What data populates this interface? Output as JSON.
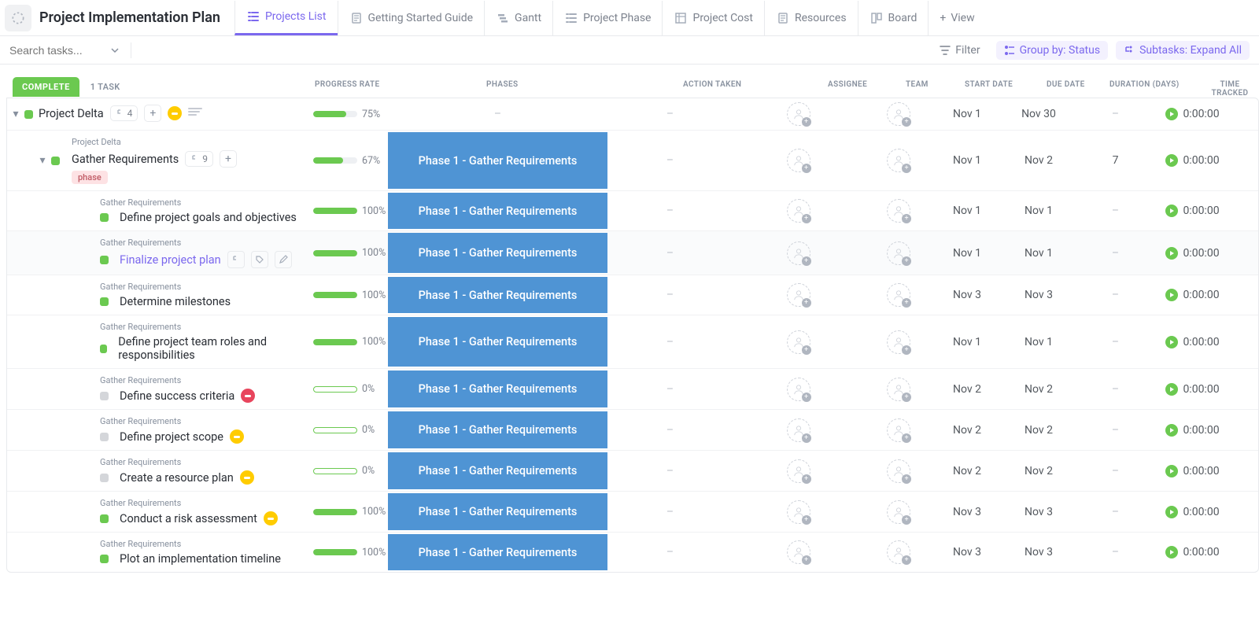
{
  "page_title": "Project Implementation Plan",
  "tabs": [
    {
      "label": "Projects List",
      "icon": "list"
    },
    {
      "label": "Getting Started Guide",
      "icon": "doc"
    },
    {
      "label": "Gantt",
      "icon": "gantt"
    },
    {
      "label": "Project Phase",
      "icon": "list"
    },
    {
      "label": "Project Cost",
      "icon": "table"
    },
    {
      "label": "Resources",
      "icon": "doc"
    },
    {
      "label": "Board",
      "icon": "board"
    }
  ],
  "view_button": "View",
  "search_placeholder": "Search tasks...",
  "toolbar": {
    "filter": "Filter",
    "groupby": "Group by: Status",
    "subtasks": "Subtasks: Expand All"
  },
  "columns": {
    "progress": "PROGRESS RATE",
    "phases": "PHASES",
    "action": "ACTION TAKEN",
    "assignee": "ASSIGNEE",
    "team": "TEAM",
    "start": "START DATE",
    "due": "DUE DATE",
    "duration": "DURATION (DAYS)",
    "time": "TIME TRACKED"
  },
  "group": {
    "name": "COMPLETE",
    "count": "1 TASK"
  },
  "rows": [
    {
      "level": 0,
      "status": "green",
      "name": "Project Delta",
      "sub_count": "4",
      "priority": "yellow",
      "has_desc": true,
      "progress": 75,
      "progress_label": "75%",
      "phase": "",
      "action": "–",
      "start": "Nov 1",
      "due": "Nov 30",
      "duration": "–",
      "time": "0:00:00",
      "breadcrumb": ""
    },
    {
      "level": 1,
      "status": "green",
      "name": "Gather Requirements",
      "breadcrumb": "Project Delta",
      "sub_count": "9",
      "tag": "phase",
      "progress": 67,
      "progress_label": "67%",
      "phase": "Phase 1 - Gather Requirements",
      "action": "–",
      "start": "Nov 1",
      "due": "Nov 2",
      "duration": "7",
      "time": "0:00:00"
    },
    {
      "level": 2,
      "status": "green",
      "name": "Define project goals and objectives",
      "breadcrumb": "Gather Requirements",
      "progress": 100,
      "progress_label": "100%",
      "phase": "Phase 1 - Gather Requirements",
      "action": "–",
      "start": "Nov 1",
      "due": "Nov 1",
      "duration": "–",
      "time": "0:00:00"
    },
    {
      "level": 2,
      "status": "green",
      "name": "Finalize project plan",
      "breadcrumb": "Gather Requirements",
      "link": true,
      "hover": true,
      "has_actions": true,
      "progress": 100,
      "progress_label": "100%",
      "phase": "Phase 1 - Gather Requirements",
      "action": "–",
      "start": "Nov 1",
      "due": "Nov 1",
      "duration": "–",
      "time": "0:00:00"
    },
    {
      "level": 2,
      "status": "green",
      "name": "Determine milestones",
      "breadcrumb": "Gather Requirements",
      "progress": 100,
      "progress_label": "100%",
      "phase": "Phase 1 - Gather Requirements",
      "action": "–",
      "start": "Nov 3",
      "due": "Nov 3",
      "duration": "–",
      "time": "0:00:00"
    },
    {
      "level": 2,
      "status": "green",
      "name": "Define project team roles and responsibilities",
      "breadcrumb": "Gather Requirements",
      "progress": 100,
      "progress_label": "100%",
      "phase": "Phase 1 - Gather Requirements",
      "action": "–",
      "start": "Nov 1",
      "due": "Nov 1",
      "duration": "–",
      "time": "0:00:00"
    },
    {
      "level": 2,
      "status": "grey",
      "name": "Define success criteria",
      "breadcrumb": "Gather Requirements",
      "priority": "red",
      "progress": 0,
      "progress_label": "0%",
      "phase": "Phase 1 - Gather Requirements",
      "action": "–",
      "start": "Nov 2",
      "due": "Nov 2",
      "due_red": true,
      "duration": "–",
      "time": "0:00:00"
    },
    {
      "level": 2,
      "status": "grey",
      "name": "Define project scope",
      "breadcrumb": "Gather Requirements",
      "priority": "yellow",
      "progress": 0,
      "progress_label": "0%",
      "phase": "Phase 1 - Gather Requirements",
      "action": "–",
      "start": "Nov 2",
      "due": "Nov 2",
      "due_red": true,
      "duration": "–",
      "time": "0:00:00"
    },
    {
      "level": 2,
      "status": "grey",
      "name": "Create a resource plan",
      "breadcrumb": "Gather Requirements",
      "priority": "yellow",
      "progress": 0,
      "progress_label": "0%",
      "phase": "Phase 1 - Gather Requirements",
      "action": "–",
      "start": "Nov 2",
      "due": "Nov 2",
      "due_red": true,
      "duration": "–",
      "time": "0:00:00"
    },
    {
      "level": 2,
      "status": "green",
      "name": "Conduct a risk assessment",
      "breadcrumb": "Gather Requirements",
      "priority": "yellow",
      "progress": 100,
      "progress_label": "100%",
      "phase": "Phase 1 - Gather Requirements",
      "action": "–",
      "start": "Nov 3",
      "due": "Nov 3",
      "duration": "–",
      "time": "0:00:00"
    },
    {
      "level": 2,
      "status": "green",
      "name": "Plot an implementation timeline",
      "breadcrumb": "Gather Requirements",
      "progress": 100,
      "progress_label": "100%",
      "phase": "Phase 1 - Gather Requirements",
      "action": "–",
      "start": "Nov 3",
      "due": "Nov 3",
      "duration": "–",
      "time": "0:00:00"
    }
  ]
}
